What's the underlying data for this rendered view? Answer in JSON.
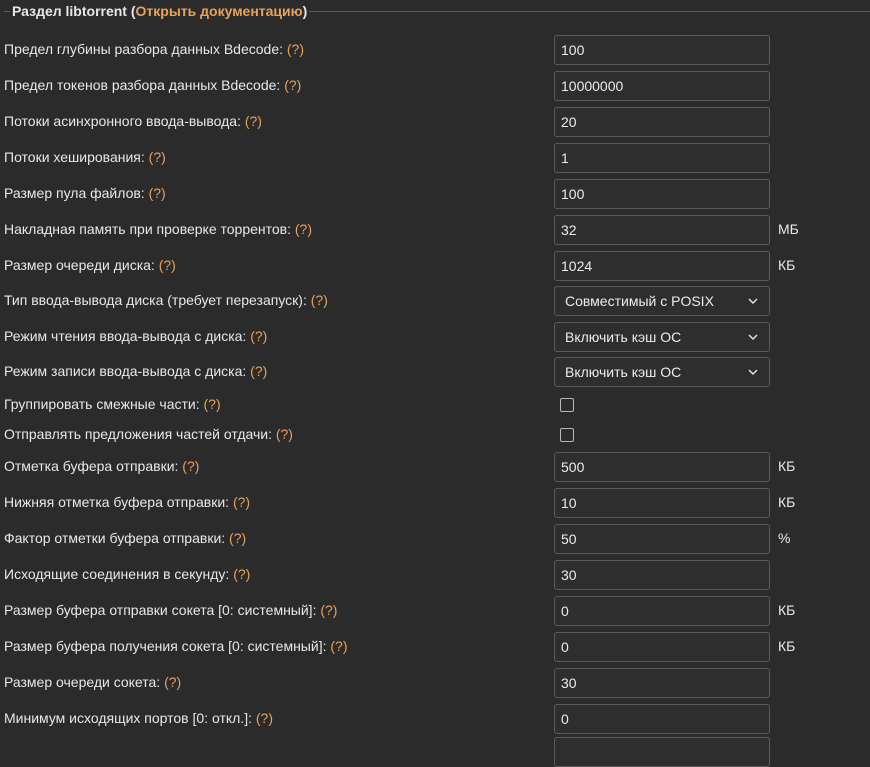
{
  "section": {
    "title": "Раздел libtorrent",
    "link_text": "Открыть документацию"
  },
  "help_text": "(?)",
  "rows": [
    {
      "label": "Предел глубины разбора данных Bdecode:",
      "type": "input",
      "value": "100",
      "unit": ""
    },
    {
      "label": "Предел токенов разбора данных Bdecode:",
      "type": "input",
      "value": "10000000",
      "unit": ""
    },
    {
      "label": "Потоки асинхронного ввода-вывода:",
      "type": "input",
      "value": "20",
      "unit": ""
    },
    {
      "label": "Потоки хеширования:",
      "type": "input",
      "value": "1",
      "unit": ""
    },
    {
      "label": "Размер пула файлов:",
      "type": "input",
      "value": "100",
      "unit": ""
    },
    {
      "label": "Накладная память при проверке торрентов:",
      "type": "input",
      "value": "32",
      "unit": "МБ"
    },
    {
      "label": "Размер очереди диска:",
      "type": "input",
      "value": "1024",
      "unit": "КБ"
    },
    {
      "label": "Тип ввода-вывода диска (требует перезапуск):",
      "type": "select",
      "value": "Совместимый с POSIX",
      "unit": ""
    },
    {
      "label": "Режим чтения ввода-вывода с диска:",
      "type": "select",
      "value": "Включить кэш ОС",
      "unit": ""
    },
    {
      "label": "Режим записи ввода-вывода с диска:",
      "type": "select",
      "value": "Включить кэш ОС",
      "unit": ""
    },
    {
      "label": "Группировать смежные части:",
      "type": "checkbox",
      "value": "",
      "unit": ""
    },
    {
      "label": "Отправлять предложения частей отдачи:",
      "type": "checkbox",
      "value": "",
      "unit": ""
    },
    {
      "label": "Отметка буфера отправки:",
      "type": "input",
      "value": "500",
      "unit": "КБ"
    },
    {
      "label": "Нижняя отметка буфера отправки:",
      "type": "input",
      "value": "10",
      "unit": "КБ"
    },
    {
      "label": "Фактор отметки буфера отправки:",
      "type": "input",
      "value": "50",
      "unit": "%"
    },
    {
      "label": "Исходящие соединения в секунду:",
      "type": "input",
      "value": "30",
      "unit": ""
    },
    {
      "label": "Размер буфера отправки сокета [0: системный]:",
      "type": "input",
      "value": "0",
      "unit": "КБ"
    },
    {
      "label": "Размер буфера получения сокета [0: системный]:",
      "type": "input",
      "value": "0",
      "unit": "КБ"
    },
    {
      "label": "Размер очереди сокета:",
      "type": "input",
      "value": "30",
      "unit": ""
    },
    {
      "label": "Минимум исходящих портов [0: откл.]:",
      "type": "input",
      "value": "0",
      "unit": ""
    },
    {
      "label": "",
      "type": "input",
      "value": "",
      "unit": ""
    }
  ]
}
